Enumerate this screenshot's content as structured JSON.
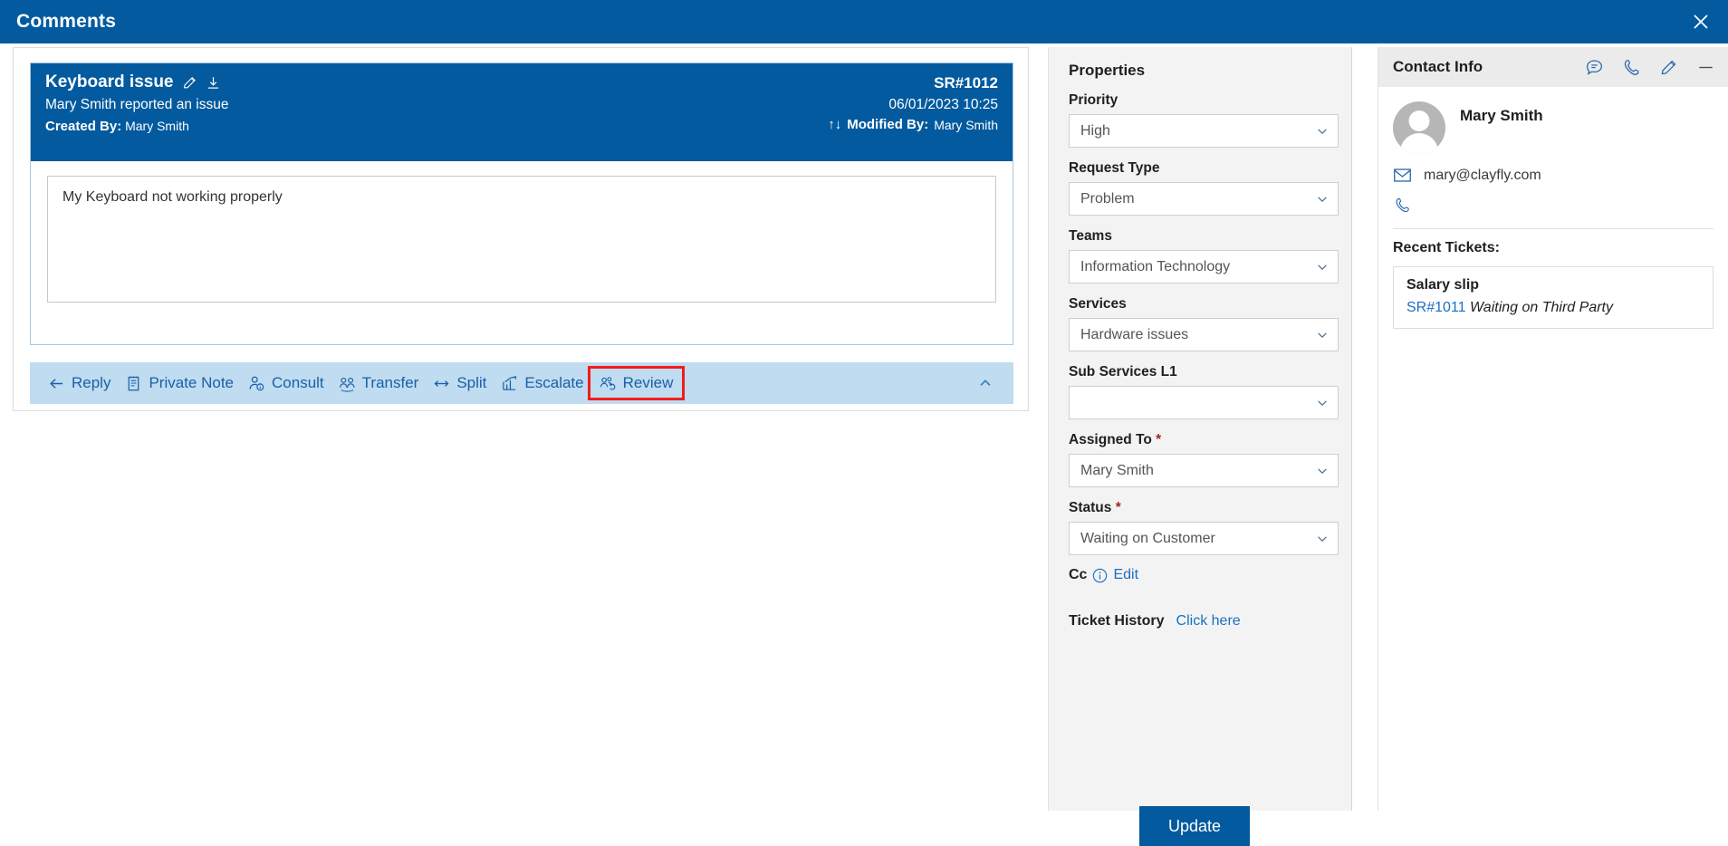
{
  "window": {
    "title": "Comments",
    "close_icon": "close-x-icon"
  },
  "ticket": {
    "title": "Keyboard issue",
    "edit_icon": "pencil-icon",
    "download_icon": "download-icon",
    "subtitle": "Mary Smith reported an issue",
    "created_by_label": "Created By:",
    "created_by_value": "Mary Smith",
    "sr_number": "SR#1012",
    "datetime": "06/01/2023 10:25",
    "sort_icon": "sort-updown-icon",
    "modified_by_label": "Modified By:",
    "modified_by_value": "Mary Smith",
    "comment_value": "My Keyboard not working properly",
    "comment_placeholder": ""
  },
  "actions": {
    "items": [
      {
        "label": "Reply",
        "icon": "reply-arrow-icon",
        "highlighted": false
      },
      {
        "label": "Private Note",
        "icon": "note-icon",
        "highlighted": false
      },
      {
        "label": "Consult",
        "icon": "person-info-icon",
        "highlighted": false
      },
      {
        "label": "Transfer",
        "icon": "people-transfer-icon",
        "highlighted": false
      },
      {
        "label": "Split",
        "icon": "split-arrows-icon",
        "highlighted": false
      },
      {
        "label": "Escalate",
        "icon": "chart-up-icon",
        "highlighted": false
      },
      {
        "label": "Review",
        "icon": "people-refresh-icon",
        "highlighted": true
      }
    ],
    "collapse_icon": "chevron-up-icon",
    "highlight_color": "#f41b1b"
  },
  "properties": {
    "heading": "Properties",
    "fields": [
      {
        "label": "Priority",
        "value": "High",
        "required": false
      },
      {
        "label": "Request Type",
        "value": "Problem",
        "required": false
      },
      {
        "label": "Teams",
        "value": "Information Technology",
        "required": false
      },
      {
        "label": "Services",
        "value": "Hardware issues",
        "required": false
      },
      {
        "label": "Sub Services L1",
        "value": "",
        "required": false
      },
      {
        "label": "Assigned To",
        "value": "Mary Smith",
        "required": true
      },
      {
        "label": "Status",
        "value": "Waiting on Customer",
        "required": true
      }
    ],
    "cc_label": "Cc",
    "cc_info_icon": "info-circle-icon",
    "cc_edit_label": "Edit",
    "ticket_history_label": "Ticket History",
    "ticket_history_link": "Click here",
    "update_button": "Update"
  },
  "contact": {
    "heading": "Contact Info",
    "header_icons": [
      {
        "name": "chat-icon"
      },
      {
        "name": "phone-icon"
      },
      {
        "name": "pencil-icon"
      },
      {
        "name": "minimize-icon"
      }
    ],
    "avatar_icon": "avatar-icon",
    "name": "Mary Smith",
    "email_icon": "mail-icon",
    "email": "mary@clayfly.com",
    "phone_icon": "phone-icon",
    "phone": "",
    "recent_tickets_label": "Recent Tickets:",
    "recent_tickets": [
      {
        "title": "Salary slip",
        "sr": "SR#1011",
        "status": "Waiting on Third Party"
      }
    ]
  },
  "colors": {
    "brand_blue": "#035a9e",
    "toolbar_blue": "#bfdcf0",
    "link_blue": "#1a6fc4",
    "highlight_red": "#f41b1b"
  }
}
